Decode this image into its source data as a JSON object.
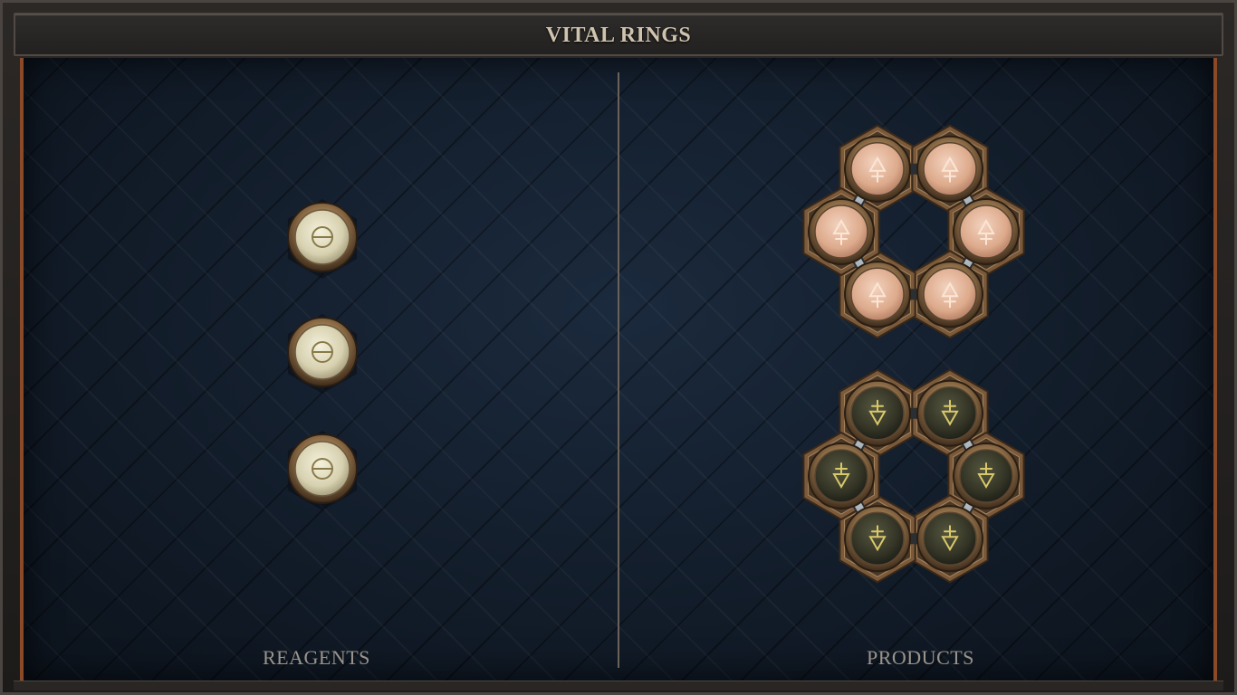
{
  "title": "VITAL RINGS",
  "panels": {
    "left_label": "REAGENTS",
    "right_label": "PRODUCTS"
  },
  "reagents": {
    "symbol_name": "salt-theta-icon",
    "count": 3
  },
  "products": [
    {
      "name": "vitae-ring",
      "symbol_name": "vitae-icon",
      "atom_count": 6,
      "color": "#e2b59a"
    },
    {
      "name": "mors-ring",
      "symbol_name": "mors-icon",
      "atom_count": 6,
      "color": "#3b3b2c"
    }
  ],
  "colors": {
    "background": "#111b28",
    "frame": "#2b2826",
    "accent": "#8a4a28",
    "title_text": "#cfc3ae",
    "label_text": "#9b948c"
  }
}
